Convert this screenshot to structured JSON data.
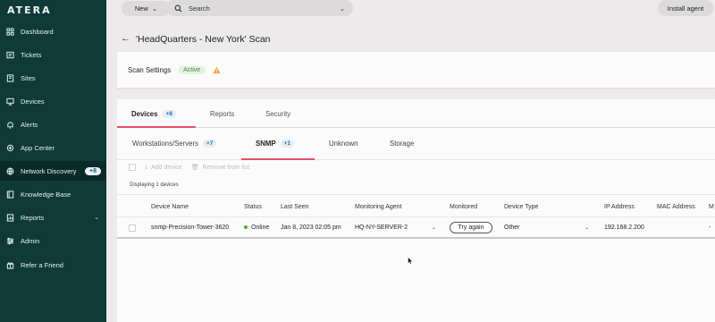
{
  "app": {
    "logo": "ATERA"
  },
  "sidebar": {
    "items": [
      {
        "label": "Dashboard",
        "icon": "dashboard-icon"
      },
      {
        "label": "Tickets",
        "icon": "ticket-icon"
      },
      {
        "label": "Sites",
        "icon": "sites-icon"
      },
      {
        "label": "Devices",
        "icon": "monitor-icon"
      },
      {
        "label": "Alerts",
        "icon": "bell-icon"
      },
      {
        "label": "App Center",
        "icon": "app-center-icon"
      },
      {
        "label": "Network Discovery",
        "icon": "network-icon",
        "badge": "+8"
      },
      {
        "label": "Knowledge Base",
        "icon": "book-icon"
      },
      {
        "label": "Reports",
        "icon": "reports-icon"
      },
      {
        "label": "Admin",
        "icon": "admin-icon"
      },
      {
        "label": "Refer a Friend",
        "icon": "gift-icon"
      }
    ]
  },
  "topbar": {
    "new_label": "New",
    "search_placeholder": "Search",
    "install_label": "Install agent"
  },
  "page": {
    "title": "'HeadQuarters - New York' Scan",
    "settings_label": "Scan Settings",
    "status_badge": "Active"
  },
  "tabs": [
    {
      "label": "Devices",
      "badge": "+8"
    },
    {
      "label": "Reports"
    },
    {
      "label": "Security"
    }
  ],
  "subtabs": [
    {
      "label": "Workstations/Servers",
      "badge": "+7"
    },
    {
      "label": "SNMP",
      "badge": "+1"
    },
    {
      "label": "Unknown"
    },
    {
      "label": "Storage"
    }
  ],
  "toolbar": {
    "add_device": "Add device",
    "remove_from_list": "Remove from list",
    "displaying": "Displaying 1 devices"
  },
  "table": {
    "columns": [
      "Device Name",
      "Status",
      "Last Seen",
      "Monitoring Agent",
      "Monitored",
      "Device Type",
      "IP Address",
      "MAC Address",
      "M"
    ],
    "rows": [
      {
        "device_name": "snmp-Precision-Tower-3620",
        "status": "Online",
        "last_seen": "Jan 8, 2023 02:05 pm",
        "monitoring_agent": "HQ-NY-SERVER-2",
        "monitored": "Try again",
        "device_type": "Other",
        "ip_address": "192.168.2.200",
        "mac_address": "",
        "extra": "-"
      }
    ]
  },
  "colors": {
    "sidebar_bg": "#0f3a37",
    "accent": "#e5506c",
    "online": "#5aa53a",
    "active_badge": "#4a8a36",
    "warning": "#f2a33a"
  }
}
